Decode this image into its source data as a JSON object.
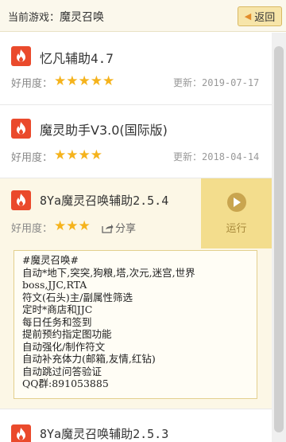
{
  "header": {
    "label": "当前游戏：",
    "game": "魔灵召唤",
    "back_label": "返回",
    "back_arrow": "◀"
  },
  "rating_label": "好用度：",
  "update_label": "更新：",
  "share_label": "分享",
  "run_label": "运行",
  "items": [
    {
      "name": "忆凡辅助4.7",
      "stars": "★★★★★",
      "date": "2019-07-17"
    },
    {
      "name": "魔灵助手V3.0(国际版)",
      "stars": "★★★★",
      "date": "2018-04-14"
    },
    {
      "name": "8Ya魔灵召唤辅助2.5.4",
      "stars": "★★★"
    },
    {
      "name": "8Ya魔灵召唤辅助2.5.3"
    }
  ],
  "description_lines": [
    "#魔灵召唤#",
    "自动*地下,突突,狗粮,塔,次元,迷宫,世界",
    "boss,JJC,RTA",
    "符文(石头)主/副属性筛选",
    "定时*商店和JJC",
    "每日任务和签到",
    "提前预约指定图功能",
    "自动强化/制作符文",
    "自动补充体力(邮箱,友情,红钻)",
    "自动跳过问答验证",
    "QQ群:891053885"
  ],
  "colors": {
    "accent": "#f5b31c",
    "logo": "#ea4a2c",
    "run_bg": "#f3dd8d"
  },
  "icons": [
    "fire-icon",
    "star-icon",
    "play-icon",
    "share-icon",
    "back-arrow-icon"
  ]
}
